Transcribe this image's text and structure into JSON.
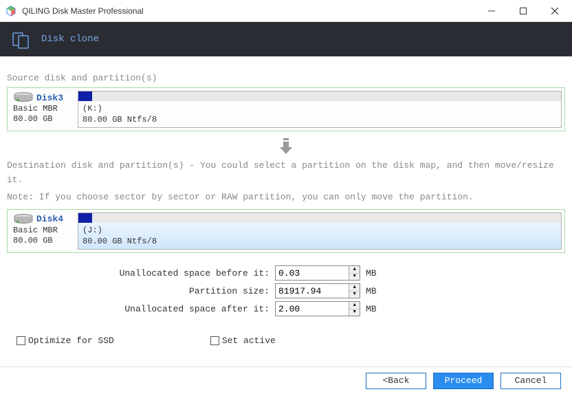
{
  "app": {
    "title": "QILING Disk Master Professional"
  },
  "header": {
    "title": "Disk clone"
  },
  "source": {
    "label": "Source disk and partition(s)",
    "disk": {
      "name": "Disk3",
      "type": "Basic MBR",
      "size": "80.00 GB",
      "partition_letter": "(K:)",
      "partition_desc": "80.00 GB Ntfs/8"
    }
  },
  "dest": {
    "label": "Destination disk and partition(s) - You could select a partition on the disk map, and then move/resize it.",
    "note": "Note: If you choose sector by sector or RAW partition, you can only move the partition.",
    "disk": {
      "name": "Disk4",
      "type": "Basic MBR",
      "size": "80.00 GB",
      "partition_letter": "(J:)",
      "partition_desc": "80.00 GB Ntfs/8"
    }
  },
  "form": {
    "before_label": "Unallocated space before it:",
    "before_value": "0.03",
    "size_label": "Partition size:",
    "size_value": "81917.94",
    "after_label": "Unallocated space after it:",
    "after_value": "2.00",
    "unit": "MB"
  },
  "options": {
    "optimize_ssd": "Optimize for SSD",
    "set_active": "Set active"
  },
  "buttons": {
    "back": "<Back",
    "proceed": "Proceed",
    "cancel": "Cancel"
  }
}
